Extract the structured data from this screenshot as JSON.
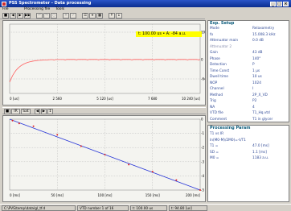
{
  "window": {
    "title": "PSS Spectrometer - Data processing"
  },
  "menu": {
    "items": [
      "File",
      "Processing file",
      "Tools"
    ]
  },
  "toolbar": {
    "buttons": [
      "■",
      "◀",
      "▶",
      "▶▶",
      "↶",
      "↷",
      "○",
      "✕",
      "✓",
      "☰",
      "⌖",
      "▦",
      "↑",
      "↓"
    ]
  },
  "top_plot": {
    "readout": "t: 100.00 us  • A: -84 a.u.",
    "y_ticks": [
      "192",
      "0",
      "-64"
    ],
    "x_ticks": [
      "0 [us]",
      "2 560",
      "5 120 [us]",
      "7 680",
      "10 240 [us]"
    ],
    "background": "#f4f4f0",
    "curve_color": "#ff6060"
  },
  "mid_toolbar": {
    "buttons": [
      "■",
      "IR",
      "Sat"
    ],
    "small_buttons": [
      "◀",
      "▶",
      "↕"
    ]
  },
  "bottom_plot": {
    "y_ticks": [
      "0",
      "-1",
      "-2",
      "-3",
      "-4",
      "-5"
    ],
    "x_ticks": [
      "0 [ms]",
      "50 [ms]",
      "100 [ms]",
      "150 [ms]",
      "200 [ms]"
    ],
    "fit_color": "#2a38d8",
    "point_color": "#e02020",
    "points": [
      [
        3,
        -0.1
      ],
      [
        10,
        -0.3
      ],
      [
        25,
        -0.5
      ],
      [
        50,
        -1.1
      ],
      [
        75,
        -1.9
      ],
      [
        100,
        -2.5
      ],
      [
        125,
        -3.2
      ],
      [
        150,
        -3.7
      ],
      [
        175,
        -4.3
      ],
      [
        200,
        -5.0
      ]
    ]
  },
  "exp_setup": {
    "title": "Exp. Setup",
    "rows": [
      {
        "key": "Mode",
        "value": "Relaxometry"
      },
      {
        "key": "fo",
        "value": "15.008.3 kHz"
      },
      {
        "key": "Attenuator main",
        "value": "0.0 dB"
      },
      {
        "key": "Attenuator 2",
        "value": ""
      },
      {
        "key": "Gain",
        "value": "43 dB"
      },
      {
        "key": "Phase",
        "value": "140°"
      },
      {
        "key": "Detection",
        "value": "P"
      },
      {
        "key": "Time Const",
        "value": "1 µs"
      },
      {
        "key": "Dwell time",
        "value": "10 us"
      },
      {
        "key": "NOP",
        "value": "1024"
      },
      {
        "key": "Channel",
        "value": "I"
      },
      {
        "key": "Method",
        "value": "2P_X_VD"
      },
      {
        "key": "Trig",
        "value": "P2"
      },
      {
        "key": "NA",
        "value": "4"
      },
      {
        "key": "VTD file",
        "value": "T1_Hq.vtd"
      },
      {
        "key": "Comment",
        "value": "T1 in glycer"
      }
    ]
  },
  "proc_param": {
    "title": "Processing Param",
    "rows": [
      {
        "key": "T1 vs IR",
        "value": ""
      },
      {
        "key": "ln(M0-M)/2M0)=-t/T1",
        "value": ""
      },
      {
        "key": "T1 =",
        "value": "47.0 [ms]"
      },
      {
        "key": "SD =",
        "value": "1.1 [ms]"
      },
      {
        "key": "M0 =",
        "value": "1183 a.u."
      }
    ]
  },
  "status": {
    "file": "C:\\PVS\\temp\\data\\gl_tf.d",
    "vtd": "VTD number 1 of 16",
    "time": "t: 100.00 us",
    "extra": "t: 94.80 [us]"
  }
}
